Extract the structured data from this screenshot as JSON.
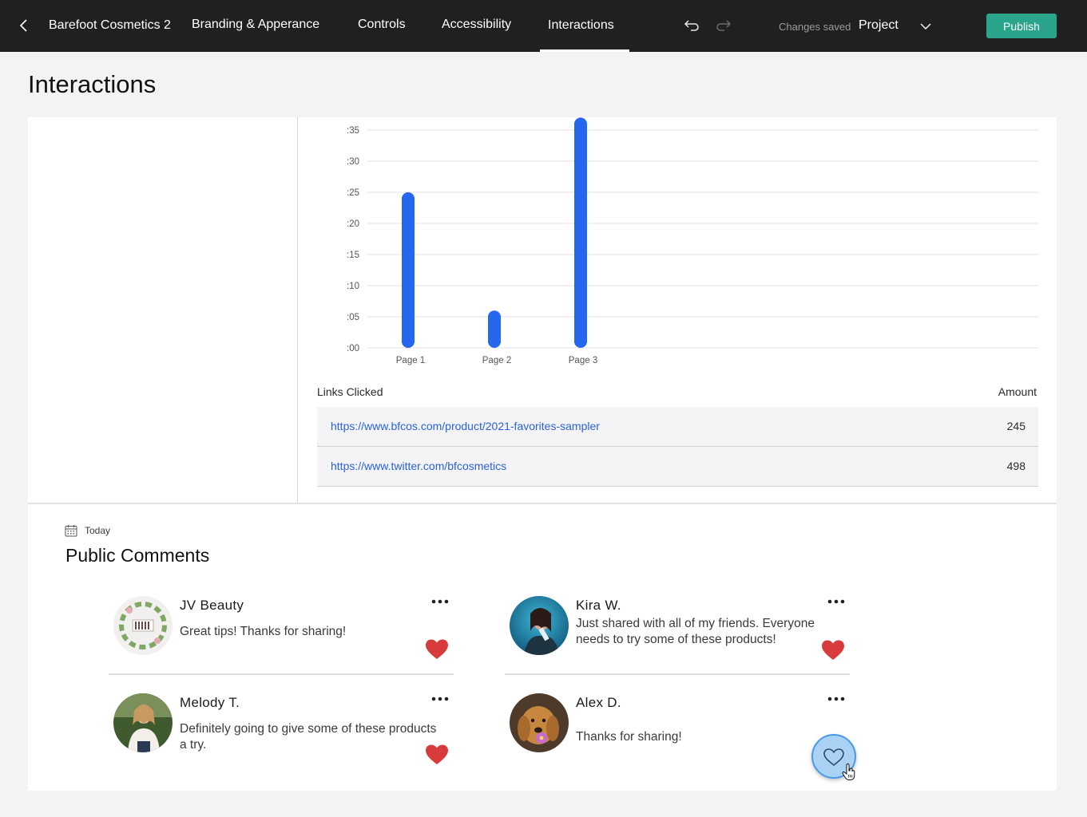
{
  "topbar": {
    "project_name": "Barefoot Cosmetics 2",
    "tabs": [
      {
        "label": "Branding & Apperance"
      },
      {
        "label": "Controls"
      },
      {
        "label": "Accessibility"
      },
      {
        "label": "Interactions",
        "active": true
      }
    ],
    "status": "Changes saved",
    "project_select": "Project",
    "publish_label": "Publish",
    "icons": [
      "back-arrow-icon",
      "undo-icon",
      "redo-icon",
      "chevron-down-icon"
    ]
  },
  "page": {
    "title": "Interactions"
  },
  "chart_data": {
    "type": "bar",
    "categories": [
      "Page 1",
      "Page 2",
      "Page 3"
    ],
    "values": [
      25,
      6,
      37
    ],
    "y_tick_labels": [
      ":00",
      ":05",
      ":10",
      ":15",
      ":20",
      ":25",
      ":30",
      ":35"
    ],
    "ylim": [
      0,
      35
    ],
    "grid": true,
    "bar_color": "#2667f0",
    "title": "",
    "xlabel": "",
    "ylabel": ""
  },
  "links": {
    "header_label": "Links Clicked",
    "amount_label": "Amount",
    "rows": [
      {
        "url": "https://www.bfcos.com/product/2021-favorites-sampler",
        "amount": "245"
      },
      {
        "url": "https://www.twitter.com/bfcosmetics",
        "amount": "498"
      }
    ]
  },
  "comments_section": {
    "date_label": "Today",
    "title": "Public Comments",
    "comments": [
      {
        "name": "JV Beauty",
        "text": "Great tips! Thanks for sharing!",
        "liked": true
      },
      {
        "name": "Kira W.",
        "text": "Just shared with all of my friends. Everyone needs to try some of these products!",
        "liked": true
      },
      {
        "name": "Melody T.",
        "text": "Definitely going to give some of these products a try.",
        "liked": true
      },
      {
        "name": "Alex D.",
        "text": "Thanks for sharing!",
        "liked": false
      }
    ]
  },
  "colors": {
    "topbar_bg": "#202022",
    "publish_bg": "#2aa58b",
    "link": "#2a63d9",
    "heart": "#d83b3b",
    "bar": "#2667f0"
  }
}
